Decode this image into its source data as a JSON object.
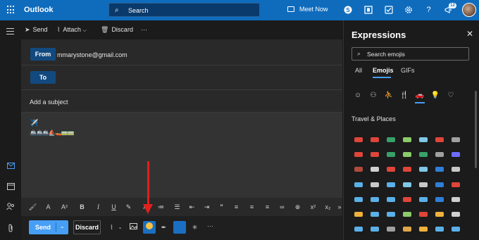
{
  "app": {
    "brand": "Outlook"
  },
  "topbar": {
    "search_placeholder": "Search",
    "meet_now": "Meet Now",
    "notification_count": "12",
    "icons": [
      "waffle-icon",
      "search-icon",
      "video-icon",
      "skype-icon",
      "office-icon",
      "todo-icon",
      "settings-icon",
      "help-icon",
      "megaphone-icon",
      "avatar"
    ]
  },
  "command_bar": {
    "send": "Send",
    "attach": "Attach",
    "discard": "Discard",
    "more": "···"
  },
  "compose": {
    "from_label": "From",
    "from_value": "mmarystone@gmail.com",
    "to_label": "To",
    "subject_placeholder": "Add a subject",
    "body_line1": "✈️",
    "body_line2": "🚢🚢🚢⛵🚤🚃🚃"
  },
  "format_bar": {
    "icons": [
      "format-painter-icon",
      "font-size-icon",
      "superscript-font-icon",
      "bold-icon",
      "italic-icon",
      "underline-icon",
      "highlight-icon",
      "font-color-icon",
      "bullets-icon",
      "numbering-icon",
      "decrease-indent-icon",
      "increase-indent-icon",
      "quote-icon",
      "align-left-icon",
      "align-center-icon",
      "align-right-icon",
      "link-icon",
      "remove-link-icon",
      "superscript-icon",
      "subscript-icon",
      "more-icon"
    ]
  },
  "send_bar": {
    "send": "Send",
    "discard": "Discard",
    "more": "···"
  },
  "expressions": {
    "title": "Expressions",
    "search_placeholder": "Search emojis",
    "tabs": [
      "All",
      "Emojis",
      "GIFs"
    ],
    "active_tab": "Emojis",
    "categories": [
      "smiley-icon",
      "people-icon",
      "activity-icon",
      "food-icon",
      "travel-icon",
      "objects-icon",
      "symbols-icon"
    ],
    "active_category": "travel-icon",
    "section": "Travel & Places",
    "emoji_colors": [
      "#e0453a",
      "#e0453a",
      "#38a169",
      "#8ccb6a",
      "#7fc8e8",
      "#e0453a",
      "#a0a0a0",
      "#e0453a",
      "#e0453a",
      "#38a169",
      "#8ccb6a",
      "#38a169",
      "#a0a0a0",
      "#6c6cff",
      "#b04a3a",
      "#d0d0d0",
      "#e0453a",
      "#e0453a",
      "#7fc8e8",
      "#2f7fd6",
      "#c8c8c8",
      "#5bb0e8",
      "#c8c8c8",
      "#5bb0e8",
      "#7fc8e8",
      "#c8c8c8",
      "#2f7fd6",
      "#e0453a",
      "#5bb0e8",
      "#5bb0e8",
      "#5bb0e8",
      "#e0453a",
      "#5bb0e8",
      "#2f7fd6",
      "#d0d0d0",
      "#f0b23a",
      "#5bb0e8",
      "#5bb0e8",
      "#8ccb6a",
      "#e0453a",
      "#f0b23a",
      "#d0d0d0",
      "#5bb0e8",
      "#5bb0e8",
      "#a0a0a0",
      "#e0a64a",
      "#f0b23a",
      "#5bb0e8",
      "#5bb0e8",
      "#5bb0e8",
      "#f0b23a",
      "#d0d0d0",
      "#d0d0d0",
      "#d0d0d0",
      "#d0d0d0",
      "#e0453a"
    ]
  }
}
